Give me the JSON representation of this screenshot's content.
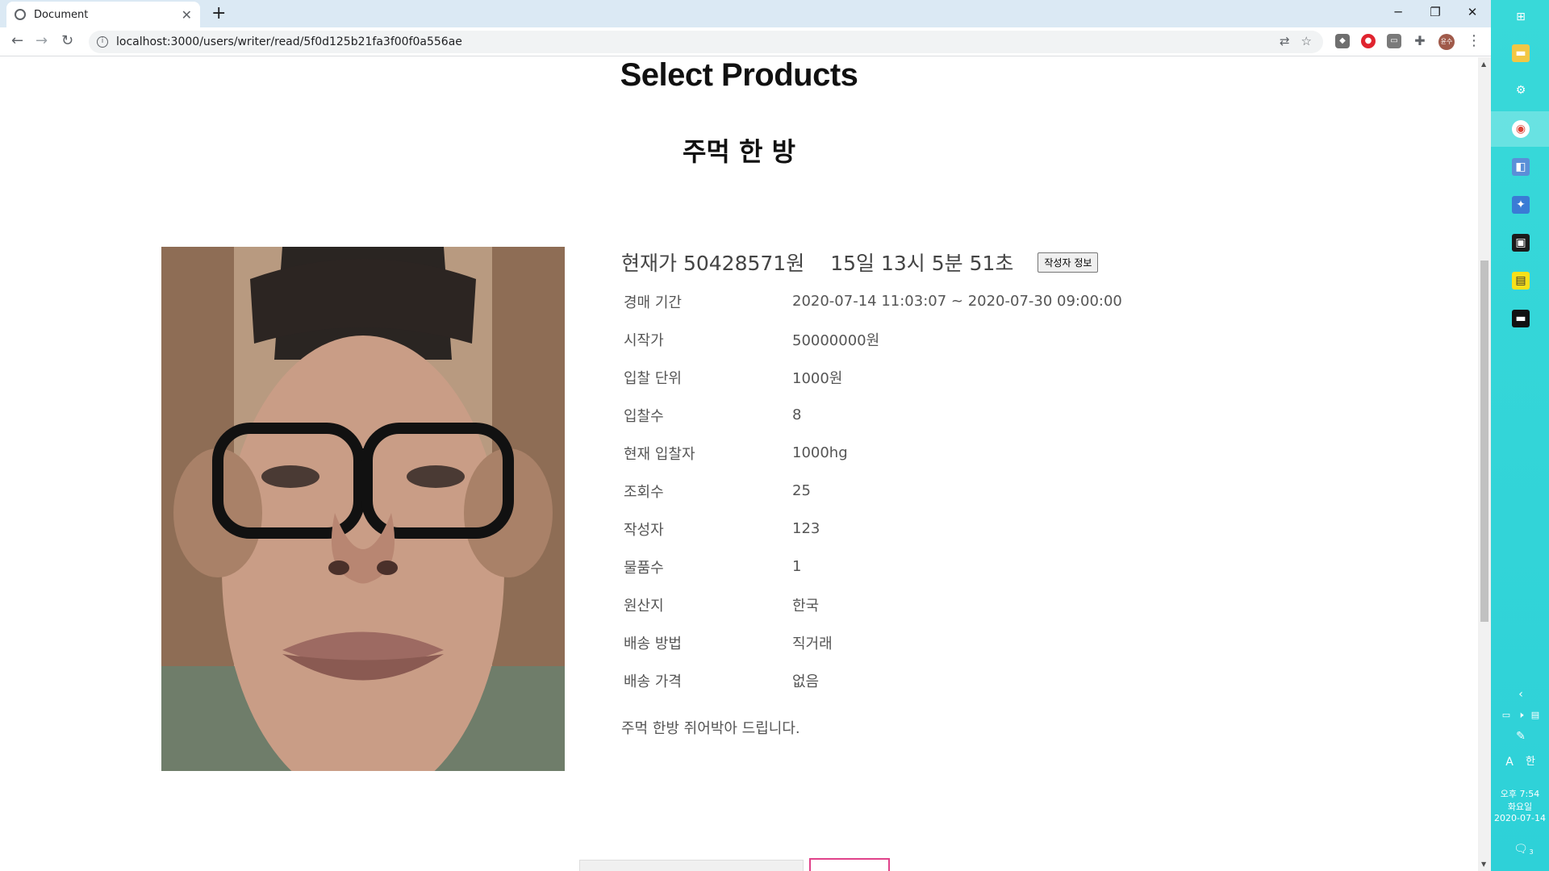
{
  "browser": {
    "tab_title": "Document",
    "new_tab": "+",
    "url": "localhost:3000/users/writer/read/5f0d125b21fa3f00f0a556ae",
    "avatar_text": "윤수",
    "window_minimize": "─",
    "window_restore": "❐",
    "window_close": "✕"
  },
  "page": {
    "title": "Select Products",
    "product_name": "주먹 한 방",
    "current_price": "현재가 50428571원",
    "time_left": "15일 13시 5분 51초",
    "writer_info_button": "작성자 정보",
    "rows": [
      {
        "label": "경매 기간",
        "value": "2020-07-14 11:03:07 ~ 2020-07-30 09:00:00"
      },
      {
        "label": "시작가",
        "value": "50000000원"
      },
      {
        "label": "입찰 단위",
        "value": "1000원"
      },
      {
        "label": "입찰수",
        "value": "8"
      },
      {
        "label": "현재 입찰자",
        "value": "1000hg"
      },
      {
        "label": "조회수",
        "value": "25"
      },
      {
        "label": "작성자",
        "value": "123"
      },
      {
        "label": "물품수",
        "value": "1"
      },
      {
        "label": "원산지",
        "value": "한국"
      },
      {
        "label": "배송 방법",
        "value": "직거래"
      },
      {
        "label": "배송 가격",
        "value": "없음"
      }
    ],
    "description": "주먹 한방 쥐어박아 드립니다."
  },
  "taskbar": {
    "time": "오후 7:54",
    "weekday": "화요일",
    "date": "2020-07-14",
    "ime_a": "A",
    "ime_han": "한",
    "notification_count": "3"
  }
}
